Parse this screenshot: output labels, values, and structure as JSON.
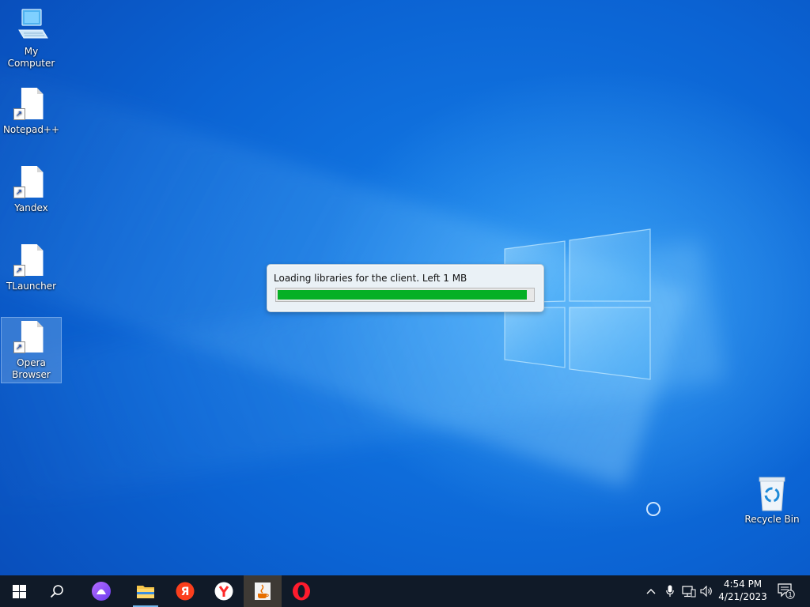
{
  "desktop": {
    "icons": [
      {
        "label": "My Computer",
        "icon": "computer-icon"
      },
      {
        "label": "Notepad++",
        "icon": "file-shortcut-icon"
      },
      {
        "label": "Yandex",
        "icon": "file-shortcut-icon"
      },
      {
        "label": "TLauncher",
        "icon": "file-shortcut-icon"
      },
      {
        "label": "Opera Browser",
        "icon": "file-shortcut-icon",
        "selected": true
      }
    ],
    "recycle_bin": {
      "label": "Recycle Bin",
      "icon": "recycle-bin-icon"
    }
  },
  "dialog": {
    "message": "Loading libraries for the client. Left 1 MB",
    "progress_percent": 98,
    "bar_color": "#06b025"
  },
  "taskbar": {
    "buttons": [
      {
        "name": "start",
        "icon": "windows-start-icon"
      },
      {
        "name": "search",
        "icon": "search-icon"
      },
      {
        "name": "alice",
        "icon": "alice-assistant-icon"
      },
      {
        "name": "file-explorer",
        "icon": "folder-icon"
      },
      {
        "name": "yandex",
        "icon": "yandex-icon"
      },
      {
        "name": "yandex-browser",
        "icon": "yandex-browser-icon"
      },
      {
        "name": "java",
        "icon": "java-icon",
        "active": true
      },
      {
        "name": "opera",
        "icon": "opera-icon"
      }
    ],
    "tray": {
      "icons": [
        "chevron-up-icon",
        "microphone-icon",
        "network-icon",
        "volume-icon"
      ],
      "time": "4:54 PM",
      "date": "4/21/2023",
      "notification_count": "1"
    }
  },
  "colors": {
    "taskbar_bg": "#101a28",
    "accent_running": "#76b9ed",
    "accent_active": "#e8862a"
  }
}
